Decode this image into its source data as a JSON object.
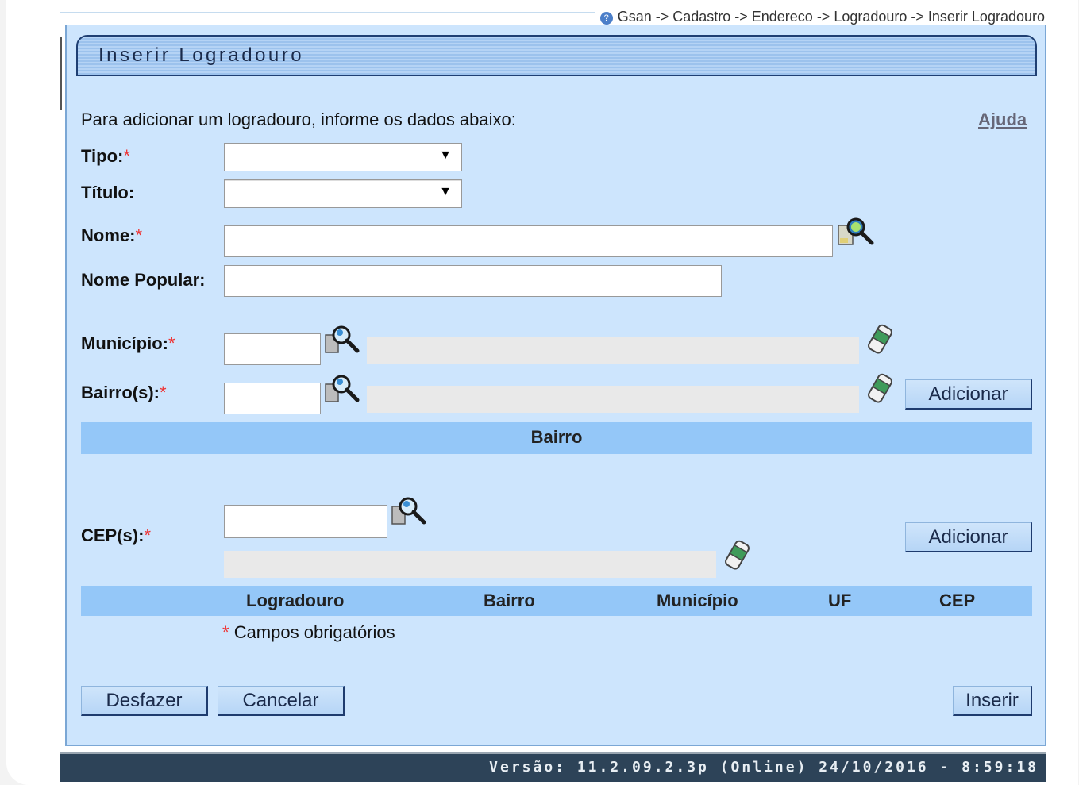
{
  "breadcrumb": {
    "text": "Gsan -> Cadastro -> Endereco -> Logradouro -> Inserir Logradouro"
  },
  "form": {
    "title": "Inserir Logradouro",
    "instructions": "Para adicionar um logradouro, informe os dados abaixo:",
    "help_link": "Ajuda",
    "required_mark": "*",
    "fields": {
      "tipo": {
        "label": "Tipo:",
        "value": ""
      },
      "titulo": {
        "label": "Título:",
        "value": ""
      },
      "nome": {
        "label": "Nome:",
        "value": ""
      },
      "nome_popular": {
        "label": "Nome Popular:",
        "value": ""
      },
      "municipio": {
        "label": "Município:",
        "code": "",
        "description": ""
      },
      "bairros": {
        "label": "Bairro(s):",
        "code": "",
        "description": ""
      },
      "ceps": {
        "label": "CEP(s):",
        "code": "",
        "description": ""
      }
    },
    "bairro_table": {
      "columns": [
        "Bairro"
      ]
    },
    "cep_table": {
      "columns": [
        "Logradouro",
        "Bairro",
        "Município",
        "UF",
        "CEP"
      ]
    },
    "required_note": "Campos obrigatórios",
    "buttons": {
      "adicionar": "Adicionar",
      "desfazer": "Desfazer",
      "cancelar": "Cancelar",
      "inserir": "Inserir"
    }
  },
  "footer": {
    "version": "Versão: 11.2.09.2.3p (Online) 24/10/2016 - 8:59:18"
  },
  "icons": {
    "search": "magnifier-search-icon",
    "clear": "eraser-icon",
    "help": "help-icon"
  },
  "colors": {
    "panel_bg": "#cde5fd",
    "header_bg": "#94c7f8",
    "footer_bg": "#2d4358",
    "required": "#e33333"
  }
}
